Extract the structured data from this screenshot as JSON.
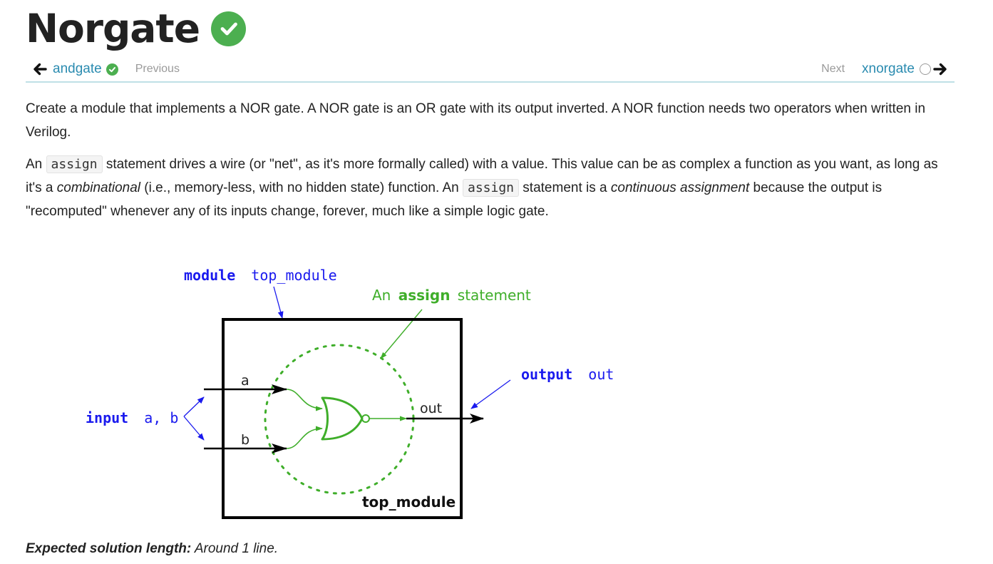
{
  "page": {
    "title": "Norgate"
  },
  "nav": {
    "prev_link": "andgate",
    "prev_hint": "Previous",
    "next_hint": "Next",
    "next_link": "xnorgate"
  },
  "description": {
    "p1": "Create a module that implements a NOR gate. A NOR gate is an OR gate with its output inverted. A NOR function needs two operators when written in Verilog.",
    "p2": {
      "t1": "An ",
      "code1": "assign",
      "t2": " statement drives a wire (or \"net\", as it's more formally called) with a value. This value can be as complex a function as you want, as long as it's a ",
      "em1": "combinational",
      "t3": " (i.e., memory-less, with no hidden state) function. An ",
      "code2": "assign",
      "t4": " statement is a ",
      "em2": "continuous assignment",
      "t5": " because the output is \"recomputed\" whenever any of its inputs change, forever, much like a simple logic gate."
    }
  },
  "diagram": {
    "module_keyword": "module",
    "module_name": "top_module",
    "assign_prefix": "An",
    "assign_keyword": "assign",
    "assign_suffix": "statement",
    "output_keyword": "output",
    "output_name": "out",
    "input_keyword": "input",
    "input_names": "a, b",
    "wire_a": "a",
    "wire_b": "b",
    "wire_out": "out",
    "box_label": "top_module"
  },
  "footer": {
    "label": "Expected solution length:",
    "value": "Around 1 line."
  },
  "colors": {
    "accent_link": "#2a8bb0",
    "check_green": "#4caf50",
    "diagram_blue": "#1a1aee",
    "diagram_green": "#3fae2a",
    "nav_rule": "#bfe0e6"
  },
  "icons": {
    "title_status": "check-circle-icon",
    "prev_arrow": "arrow-left-icon",
    "prev_status": "check-circle-icon",
    "next_status": "empty-circle-icon",
    "next_arrow": "arrow-right-icon"
  }
}
